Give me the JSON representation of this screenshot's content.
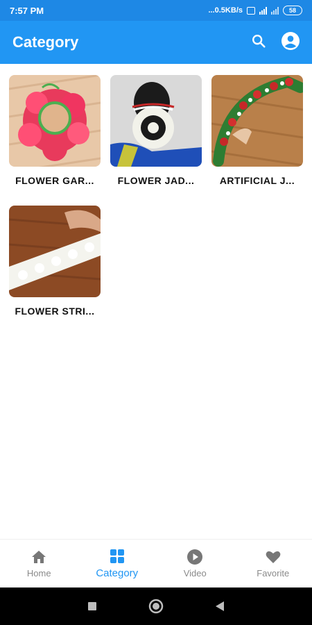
{
  "status": {
    "time": "7:57 PM",
    "net_speed": "...0.5KB/s",
    "battery": "58"
  },
  "header": {
    "title": "Category",
    "icons": [
      "search-icon",
      "account-icon"
    ]
  },
  "categories": [
    {
      "label": "FLOWER GAR...",
      "image": "red-flower-garland"
    },
    {
      "label": "FLOWER JAD...",
      "image": "jasmine-hair-bun"
    },
    {
      "label": "ARTIFICIAL J...",
      "image": "artificial-red-flower-jada"
    },
    {
      "label": "FLOWER STRI...",
      "image": "white-jasmine-string"
    }
  ],
  "bottom_nav": [
    {
      "label": "Home",
      "icon": "home-icon",
      "active": false
    },
    {
      "label": "Category",
      "icon": "grid-icon",
      "active": true
    },
    {
      "label": "Video",
      "icon": "play-icon",
      "active": false
    },
    {
      "label": "Favorite",
      "icon": "heart-icon",
      "active": false
    }
  ],
  "colors": {
    "primary": "#2196F3",
    "status_bar": "#1E88E5",
    "inactive": "#8a8a8a"
  }
}
